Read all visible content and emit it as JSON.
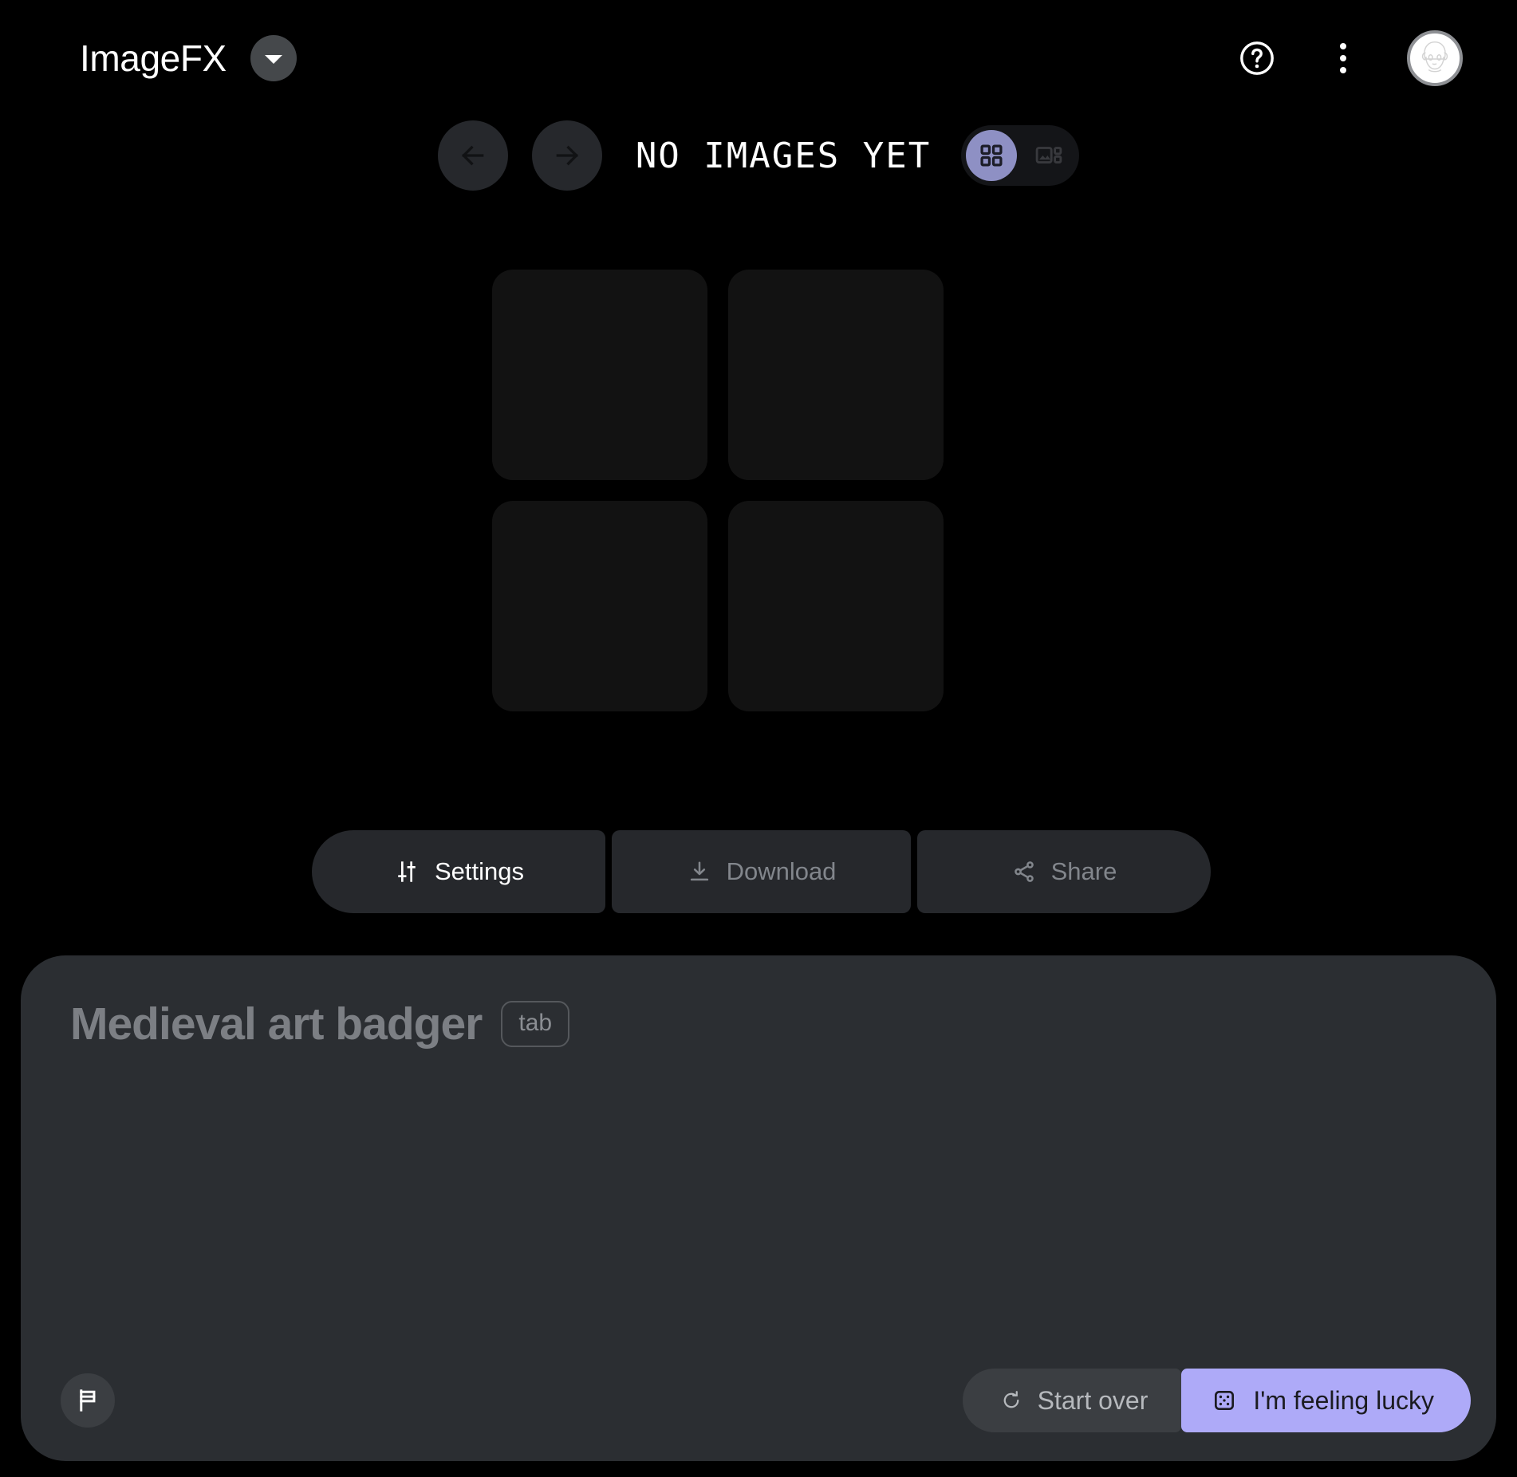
{
  "app": {
    "title": "ImageFX"
  },
  "topbar": {
    "brand_caret_icon": "chevron-down-icon",
    "help_icon": "help-circle-icon",
    "more_icon": "kebab-menu-icon",
    "avatar_icon": "user-avatar-icon"
  },
  "gallery": {
    "title": "NO IMAGES YET",
    "prev_icon": "arrow-left-icon",
    "next_icon": "arrow-right-icon",
    "view_modes": [
      {
        "id": "grid",
        "icon": "grid-view-icon",
        "active": true
      },
      {
        "id": "single",
        "icon": "single-image-view-icon",
        "active": false
      }
    ],
    "tiles": [
      {
        "id": "tile-1"
      },
      {
        "id": "tile-2"
      },
      {
        "id": "tile-3"
      },
      {
        "id": "tile-4"
      }
    ]
  },
  "actions": {
    "settings_label": "Settings",
    "settings_icon": "tune-sliders-icon",
    "settings_enabled": true,
    "download_label": "Download",
    "download_icon": "download-icon",
    "download_enabled": false,
    "share_label": "Share",
    "share_icon": "share-icon",
    "share_enabled": false
  },
  "prompt": {
    "placeholder": "Medieval art badger",
    "value": "",
    "tab_chip_label": "tab",
    "flag_icon": "flag-icon",
    "start_over_label": "Start over",
    "start_over_icon": "refresh-icon",
    "lucky_label": "I'm feeling lucky",
    "lucky_icon": "dice-icon"
  },
  "colors": {
    "background": "#000000",
    "accent": "#aeaaf8",
    "toggle_active": "#8e90c4",
    "panel": "#2b2e32",
    "tile": "#121212",
    "button": "#26282c",
    "disabled_text": "#82868c"
  }
}
